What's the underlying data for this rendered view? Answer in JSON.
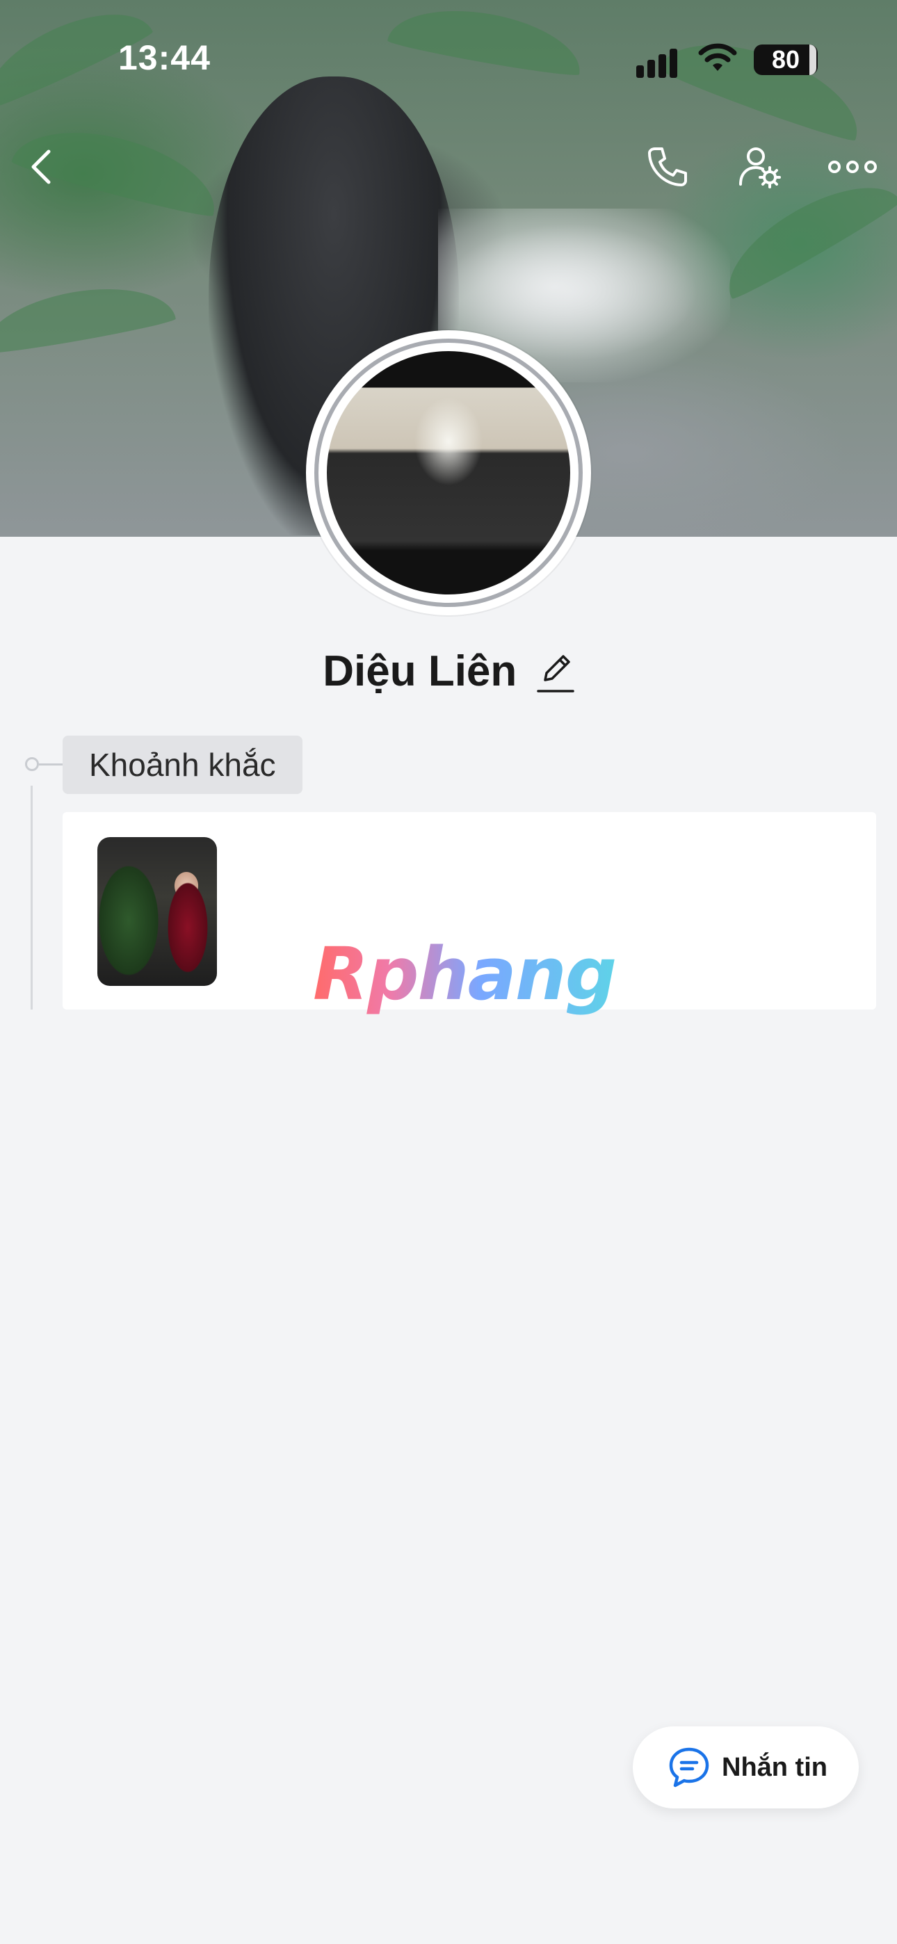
{
  "status_bar": {
    "time": "13:44",
    "battery": "80"
  },
  "header": {
    "back_icon": "chevron-left-icon",
    "call_icon": "phone-icon",
    "profile_settings_icon": "user-gear-icon",
    "more_icon": "more-horizontal-icon"
  },
  "profile": {
    "name": "Diệu Liên",
    "edit_icon": "pencil-icon"
  },
  "moments": {
    "label": "Khoảnh khắc"
  },
  "watermark": "Rphang",
  "message_button": {
    "label": "Nhắn tin",
    "icon": "chat-bubble-icon",
    "accent": "#1a73e8"
  }
}
